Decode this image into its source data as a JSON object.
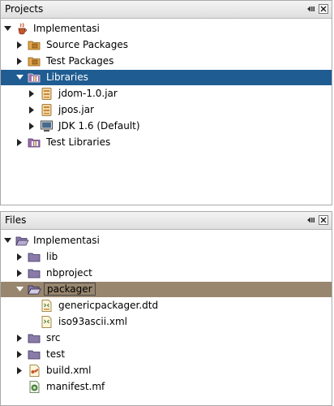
{
  "projects_panel": {
    "title": "Projects",
    "tree": {
      "root": "Implementasi",
      "source_packages": "Source Packages",
      "test_packages": "Test Packages",
      "libraries": "Libraries",
      "jar1": "jdom-1.0.jar",
      "jar2": "jpos.jar",
      "jdk": "JDK 1.6 (Default)",
      "test_libraries": "Test Libraries"
    }
  },
  "files_panel": {
    "title": "Files",
    "tree": {
      "root": "Implementasi",
      "lib": "lib",
      "nbproject": "nbproject",
      "packager": "packager",
      "dtd": "genericpackager.dtd",
      "xml": "iso93ascii.xml",
      "src": "src",
      "test": "test",
      "build": "build.xml",
      "manifest": "manifest.mf"
    }
  },
  "colors": {
    "selection_blue": "#1f5c92",
    "selection_tan": "#98866e"
  }
}
